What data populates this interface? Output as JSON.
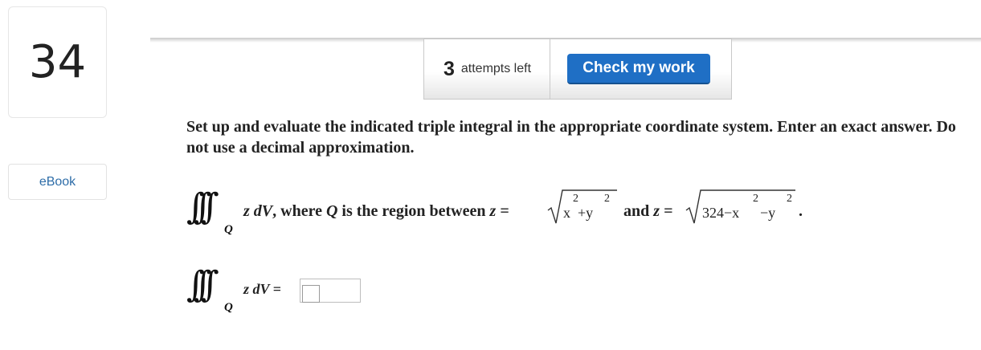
{
  "question": {
    "number": "34"
  },
  "sidebar": {
    "ebook_label": "eBook"
  },
  "attempts": {
    "count": "3",
    "label": "attempts left"
  },
  "check_button": {
    "label": "Check my work"
  },
  "problem": {
    "instructions": "Set up and evaluate the indicated triple integral in the appropriate coordinate system. Enter an exact answer. Do not use a decimal approximation.",
    "integrand": "z dV",
    "region_symbol": "Q",
    "where_text": ", where",
    "region_text": "Q",
    "region_desc": "is the region between",
    "z_eq_1": "z =",
    "sqrt1": {
      "x": "x",
      "plus": "+y",
      "exp_x": "2",
      "exp_y": "2"
    },
    "and_text": "and",
    "z_eq_2": "z =",
    "sqrt2": {
      "const": "324−x",
      "minus": "−y",
      "exp_x": "2",
      "exp_y": "2"
    },
    "period": ".",
    "answer_prefix": "z dV ="
  },
  "answer": {
    "value": ""
  }
}
